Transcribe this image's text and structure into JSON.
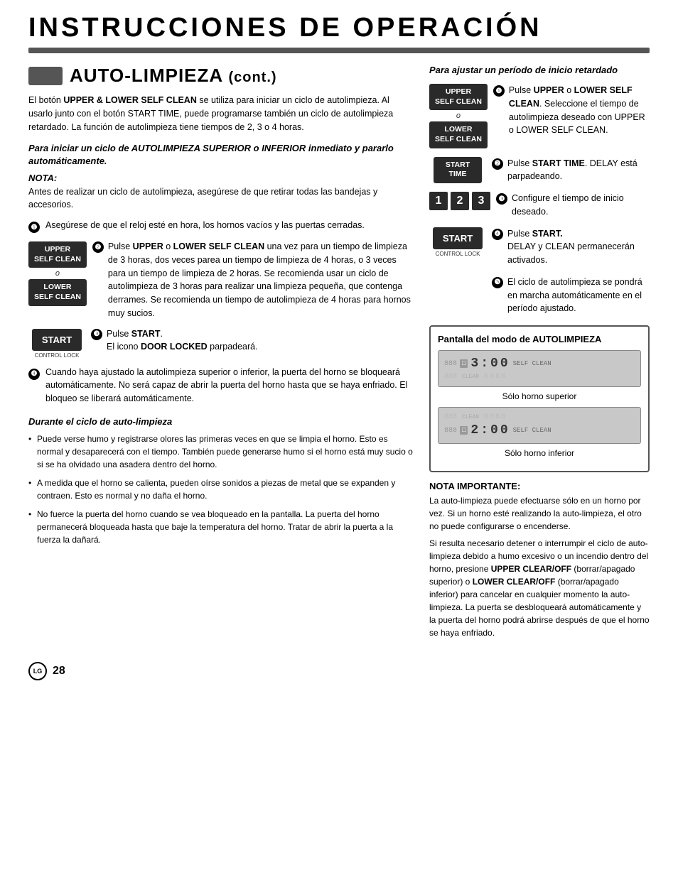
{
  "header": {
    "title": "INSTRUCCIONES DE OPERACIÓN"
  },
  "section": {
    "title": "AUTO-LIMPIEZA",
    "cont": "(cont.)",
    "intro": "El botón UPPER & LOWER SELF CLEAN se utiliza para iniciar un ciclo de autolimpieza. Al usarlo junto con el botón START TIME, puede programarse también un ciclo de autolimpieza retardado. La función de autolimpieza tiene tiempos de 2, 3 o 4 horas."
  },
  "left_col": {
    "sub_heading": "Para iniciar un ciclo de AUTOLIMPIEZA SUPERIOR o INFERIOR inmediato y pararlo automáticamente.",
    "nota_label": "NOTA:",
    "nota_text": "Antes de realizar un ciclo de autolimpieza, asegúrese de que retirar todas las bandejas y accesorios.",
    "step1_text": "Asegúrese de que el reloj esté en hora, los hornos vacíos y las puertas cerradas.",
    "upper_btn_line1": "UPPER",
    "upper_btn_line2": "SELF CLEAN",
    "or_text": "o",
    "lower_btn_line1": "LOWER",
    "lower_btn_line2": "SELF CLEAN",
    "step2_num": "❷",
    "step2_text": "Pulse UPPER o LOWER SELF CLEAN una vez para un tiempo de limpieza de 3 horas, dos veces parea un tiempo de limpieza de 4 horas, o 3 veces para un tiempo de limpieza de 2 horas. Se recomienda usar un ciclo de autolimpieza de 3 horas para realizar una limpieza pequeña, que contenga derrames. Se recomienda un tiempo de autolimpieza de 4 horas para hornos muy sucios.",
    "step3_num": "❸",
    "step3_text_a": "Pulse ",
    "step3_bold": "START",
    "step3_text_b": ".\nEl icono ",
    "step3_bold2": "DOOR LOCKED",
    "step3_text_c": " parpadeará.",
    "start_btn": "START",
    "control_lock": "CONTROL LOCK",
    "step4_num": "❹",
    "step4_text": "Cuando haya ajustado la autolimpieza superior o inferior, la puerta del horno se bloqueará automáticamente. No será capaz de abrir la puerta del horno hasta que se haya enfriado. El bloqueo se liberará automáticamente.",
    "durante_heading": "Durante el ciclo de auto-limpieza",
    "bullet1": "Puede verse humo y registrarse olores las primeras veces en que se limpia el horno. Esto es normal y desaparecerá con el tiempo. También puede generarse humo si el horno está muy sucio o si se ha olvidado una asadera dentro del horno.",
    "bullet2": "A medida que el horno se calienta, pueden oírse sonidos a piezas de metal que se expanden y contraen. Esto es normal y no daña el horno.",
    "bullet3": "No fuerce la puerta del horno cuando se vea bloqueado en la pantalla. La puerta del horno permanecerá bloqueada hasta que baje la temperatura del horno. Tratar de abrir la puerta a la fuerza la dañará."
  },
  "right_col": {
    "section_title": "Para ajustar un período de inicio retardado",
    "upper_btn_line1": "UPPER",
    "upper_btn_line2": "SELF CLEAN",
    "or_text": "o",
    "lower_btn_line1": "LOWER",
    "lower_btn_line2": "SELF CLEAN",
    "step1_text": "Pulse UPPER o LOWER SELF CLEAN. Seleccione el tiempo de autolimpieza deseado con UPPER o LOWER SELF CLEAN.",
    "start_time_btn_line1": "START",
    "start_time_btn_line2": "TIME",
    "step2_text": "Pulse START TIME. DELAY está parpadeando.",
    "numbers": [
      "1",
      "2",
      "3"
    ],
    "step3_text": "Configure el tiempo de inicio deseado.",
    "start_btn": "START",
    "control_lock": "CONTROL LOCK",
    "step4_text_a": "Pulse ",
    "step4_bold": "START.",
    "step4_text_b": "\nDELAY y CLEAN permanecerán activados.",
    "step5_text": "El ciclo de autolimpieza se pondrá en marcha automáticamente en el período ajustado.",
    "pantalla_title": "Pantalla del modo de AUTOLIMPIEZA",
    "screen1_time": "3:00",
    "screen1_caption": "Sólo horno superior",
    "screen2_time": "2:00",
    "screen2_caption": "Sólo horno inferior",
    "nota_imp_label": "NOTA IMPORTANTE:",
    "nota_imp_text1": "La auto-limpieza puede efectuarse sólo en un horno por vez. Si un horno esté realizando la auto-limpieza, el otro no puede configurarse o encenderse.",
    "nota_imp_text2": "Si resulta necesario detener o interrumpir el ciclo de auto-limpieza debido a humo excesivo o un incendio dentro del horno, presione UPPER CLEAR/OFF (borrar/apagado superior) o LOWER CLEAR/OFF (borrar/apagado inferior) para cancelar en cualquier momento la auto-limpieza. La puerta se desbloqueará automáticamente y la puerta del horno podrá abrirse después de que el horno se haya enfriado."
  },
  "footer": {
    "logo": "LG",
    "page_num": "28"
  }
}
